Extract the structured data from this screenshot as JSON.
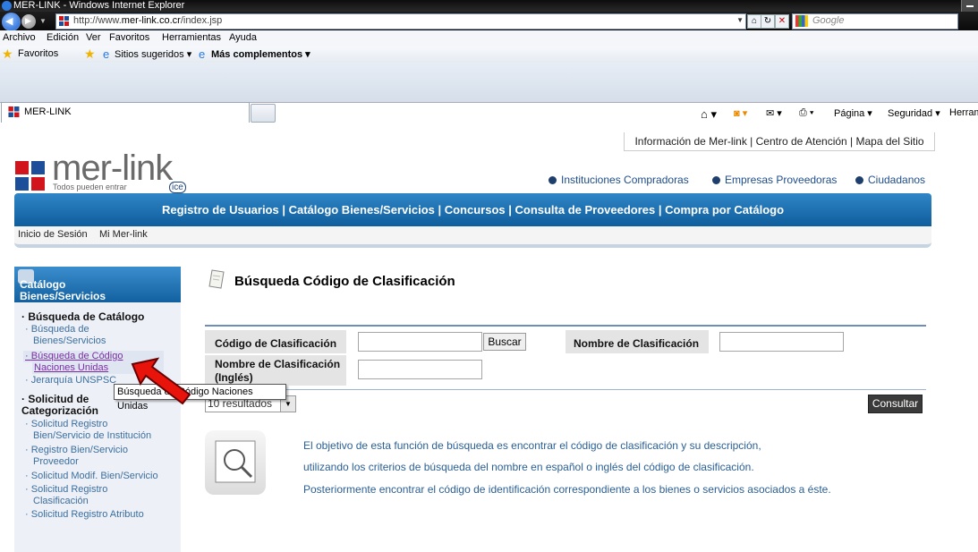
{
  "browser": {
    "window_title": "MER-LINK - Windows Internet Explorer",
    "url_prefix": "http://www.",
    "url_domain": "mer-link.co.cr",
    "url_suffix": "/index.jsp",
    "search_placeholder": "Google",
    "menu": [
      "Archivo",
      "Edición",
      "Ver",
      "Favoritos",
      "Herramientas",
      "Ayuda"
    ],
    "favorites_label": "Favoritos",
    "suggested_sites": "Sitios sugeridos ▾",
    "more_addons": "Más complementos ▾",
    "tab_label": "MER-LINK",
    "cmd_page": "Página ▾",
    "cmd_security": "Seguridad ▾",
    "cmd_tools": "Herramientas"
  },
  "site": {
    "top_links": "Información de Mer-link | Centro de Atención | Mapa del Sitio",
    "logo_word": "mer-link",
    "logo_tagline": "Todos pueden entrar",
    "logo_badge": "ice",
    "role_links": [
      "Instituciones Compradoras",
      "Empresas Proveedoras",
      "Ciudadanos"
    ],
    "main_nav": "Registro de Usuarios | Catálogo Bienes/Servicios | Concursos | Consulta de Proveedores | Compra por Catálogo",
    "sub_nav": [
      "Inicio de Sesión",
      "Mi Mer-link"
    ]
  },
  "sidebar": {
    "header_line1": "Catálogo",
    "header_line2": "Bienes/Servicios",
    "section1": "Búsqueda de Catálogo",
    "section1_items": [
      "Búsqueda de",
      "Bienes/Servicios",
      "Búsqueda de Código",
      "Naciones Unidas",
      "Jerarquía UNSPSC"
    ],
    "section2_line1": "Solicitud de",
    "section2_line2": "Categorización",
    "section2_items": [
      "Solicitud Registro",
      "Bien/Servicio de Institución",
      "Registro Bien/Servicio",
      "Proveedor",
      "Solicitud Modif. Bien/Servicio",
      "Solicitud Registro",
      "Clasificación",
      "Solicitud Registro Atributo"
    ]
  },
  "content": {
    "title": "Búsqueda Código de Clasificación",
    "code_label": "Código de Clasificación",
    "search_button": "Buscar",
    "name_label": "Nombre de Clasificación",
    "name_en_label_1": "Nombre de Clasificación",
    "name_en_label_2": "(Inglés)",
    "results_value": "10 resultados",
    "consult_button": "Consultar",
    "desc_lines": [
      "El objetivo de esta función de búsqueda es encontrar el código de clasificación y su descripción,",
      "utilizando los criterios de búsqueda del nombre en español o inglés del código de clasificación.",
      "Posteriormente encontrar el código de identificación correspondiente a los bienes o servicios asociados a éste."
    ],
    "tooltip": "Búsqueda de Código Naciones Unidas"
  },
  "colors": {
    "nav_blue": "#1a6aab",
    "link_blue": "#3c6e9e",
    "arrow_red": "#e8140c"
  }
}
